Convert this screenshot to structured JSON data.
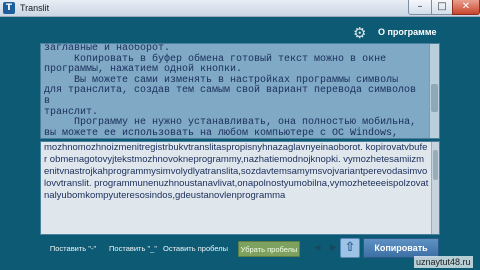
{
  "window": {
    "title": "Translit",
    "app_icon_glyph": "T",
    "controls": {
      "minimize": "–",
      "maximize": "□",
      "close": "✕"
    }
  },
  "header": {
    "settings_icon": "gear-icon",
    "about_label": "О программе"
  },
  "upper_text": "заглавные и наоборот.\n     Копировать в буфер обмена готовый текст можно в окне\nпрограммы, нажатием одной кнопки.\n     Вы можете сами изменять в настройках программы символы\nдля транслита, создав тем самым свой вариант перевода символов в\nтранслит.\n     Программу не нужно устанавливать, она полностью мобильна,\nвы можете ее использовать на любом компьютере с ОС Windows,",
  "lower_text": "mozhnomozhnoizmenitregistrbukvtranslitaspropisnyhnazaglavnyeinaoborot.\nkopirovatvbufer obmenagotovyjtekstmozhnovokneprogrammy,nazhatiemodnojknopki.\nvymozhetesamiizmenitvnastrojkahprogrammysimvolydlyatranslita,sozdavtemsamymsvojvariantperevodasimvolovvtranslit.\nprogrammunenuzhnoustanavlivat,onapolnostyumobilna,vymozheteeeispolzovatnalyubomkompyuteresosindos,gdeustanovlenprogramma",
  "toolbar": {
    "put_quote1": "Поставить \"-\"",
    "put_quote2": "Поставить \"_\"",
    "keep_spaces": "Оставить пробелы",
    "remove_spaces": "Убрать пробелы",
    "arrow_left": "◂",
    "arrow_right": "▸",
    "up_glyph": "⇧",
    "copy": "Копировать"
  },
  "watermark": "uznaytut48.ru",
  "colors": {
    "window_bg": "#0c5a73",
    "upper_panel_bg": "#7fa9c4",
    "lower_panel_bg": "#dfe6ec",
    "remove_spaces_bg": "#7ea15f",
    "copy_button_bg": "#3c6fa5"
  }
}
